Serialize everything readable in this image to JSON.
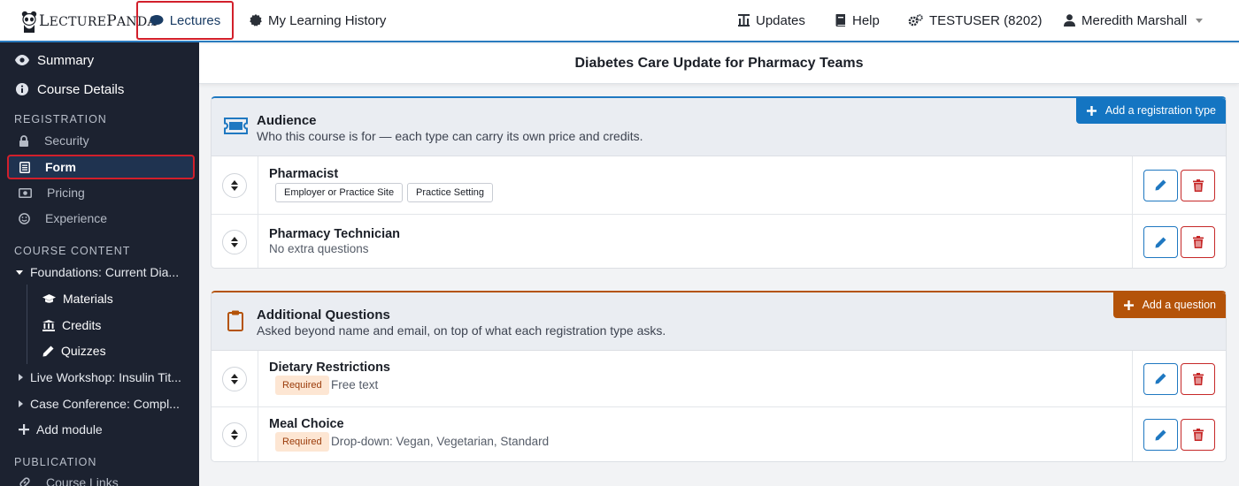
{
  "brand": {
    "name_cap1": "L",
    "name_rest1": "ECTURE",
    "name_cap2": "P",
    "name_rest2": "ANDA"
  },
  "topnav": {
    "lectures": "Lectures",
    "history": "My Learning History",
    "updates": "Updates",
    "help": "Help",
    "account": "TESTUSER (8202)",
    "user": "Meredith Marshall"
  },
  "sidebar": {
    "summary": "Summary",
    "course_details": "Course Details",
    "registration_heading": "REGISTRATION",
    "security": "Security",
    "form": "Form",
    "pricing": "Pricing",
    "experience": "Experience",
    "content_heading": "COURSE CONTENT",
    "module1": "Foundations: Current Dia...",
    "materials": "Materials",
    "credits": "Credits",
    "quizzes": "Quizzes",
    "module2": "Live Workshop: Insulin Tit...",
    "module3": "Case Conference: Compl...",
    "add_module": "Add module",
    "publication_heading": "PUBLICATION",
    "course_links": "Course Links"
  },
  "page_title": "Diabetes Care Update for Pharmacy Teams",
  "audience": {
    "title": "Audience",
    "subtitle": "Who this course is for — each type can carry its own price and credits.",
    "add_label": "Add a registration type",
    "rows": [
      {
        "title": "Pharmacist",
        "chips": [
          "Employer or Practice Site",
          "Practice Setting"
        ]
      },
      {
        "title": "Pharmacy Technician",
        "note": "No extra questions"
      }
    ]
  },
  "questions": {
    "title": "Additional Questions",
    "subtitle": "Asked beyond name and email, on top of what each registration type asks.",
    "add_label": "Add a question",
    "rows": [
      {
        "title": "Dietary Restrictions",
        "badge": "Required",
        "detail": "Free text"
      },
      {
        "title": "Meal Choice",
        "badge": "Required",
        "detail": "Drop-down: Vegan, Vegetarian, Standard"
      }
    ]
  },
  "colors": {
    "accent": "#1475c2",
    "orange": "#b45309",
    "danger": "#c62828",
    "sidebar": "#1c2230"
  }
}
